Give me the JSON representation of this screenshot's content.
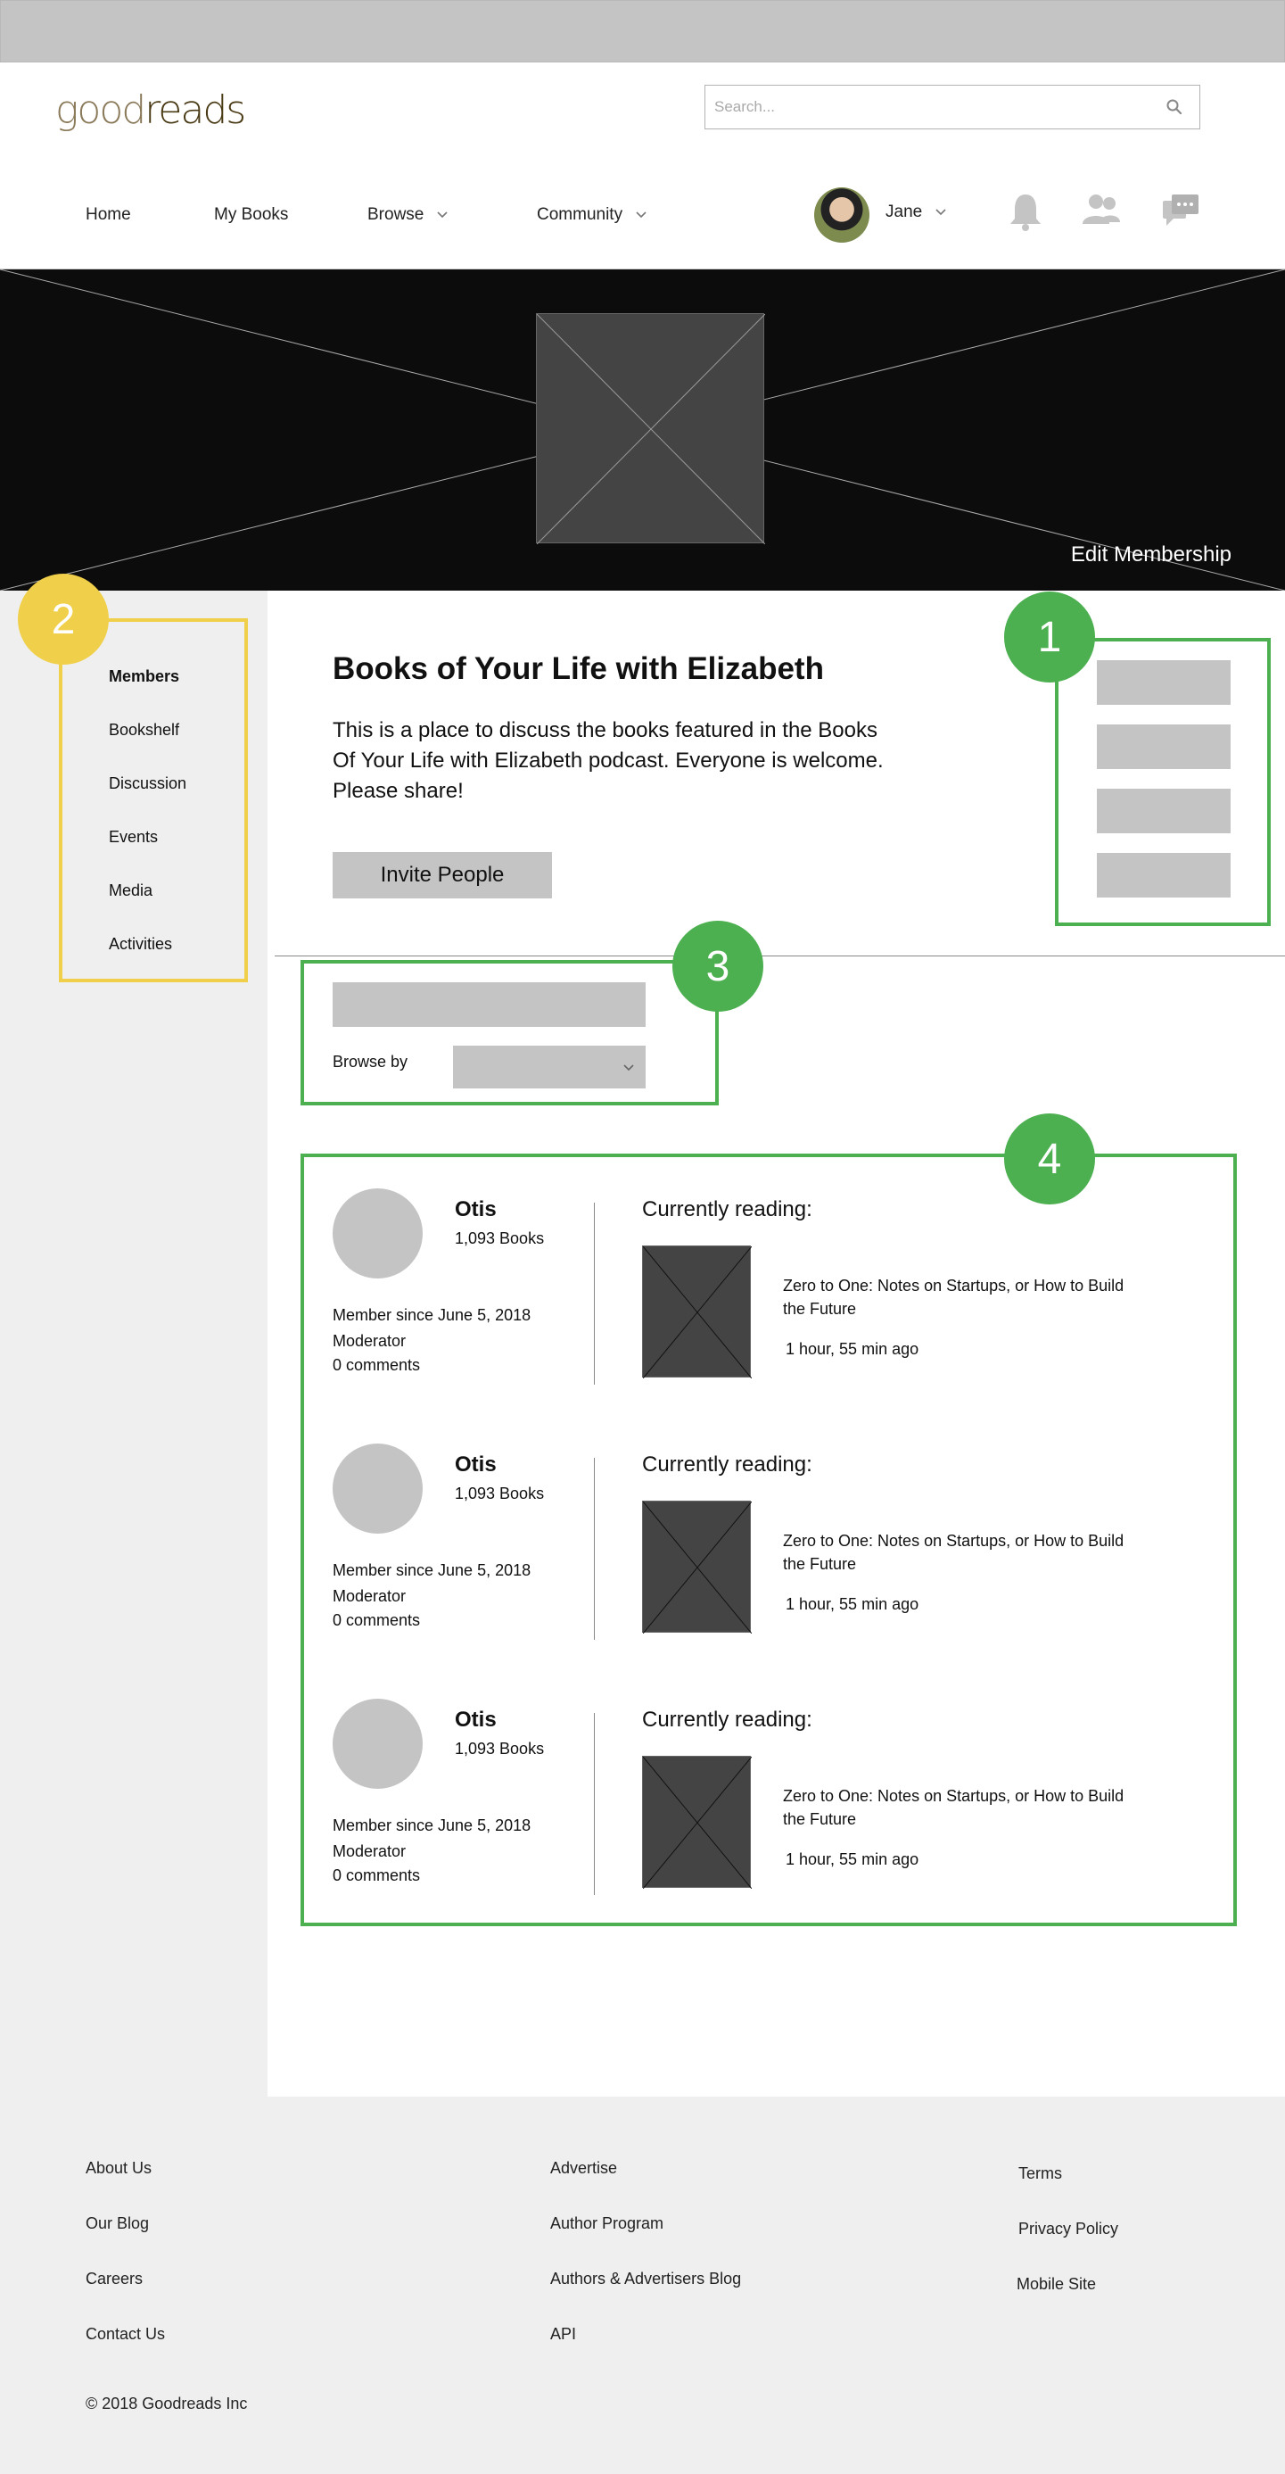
{
  "brand": {
    "logo_part1": "good",
    "logo_part2": "reads"
  },
  "search": {
    "placeholder": "Search..."
  },
  "nav": {
    "home": "Home",
    "my_books": "My Books",
    "browse": "Browse",
    "community": "Community"
  },
  "user": {
    "name": "Jane"
  },
  "header_icons": [
    "bell-icon",
    "friends-icon",
    "messages-icon"
  ],
  "banner": {
    "edit_membership": "Edit Membership"
  },
  "annotations": {
    "one": "1",
    "two": "2",
    "three": "3",
    "four": "4"
  },
  "sidebar": {
    "items": [
      {
        "label": "Members"
      },
      {
        "label": "Bookshelf"
      },
      {
        "label": "Discussion"
      },
      {
        "label": "Events"
      },
      {
        "label": "Media"
      },
      {
        "label": "Activities"
      }
    ]
  },
  "group": {
    "title": "Books of Your Life with Elizabeth",
    "description": "This is a place to discuss the books featured in the Books Of Your Life with Elizabeth podcast. Everyone is welcome. Please share!",
    "invite_label": "Invite People"
  },
  "filters": {
    "browse_label": "Browse by"
  },
  "members": [
    {
      "name": "Otis",
      "books": "1,093 Books",
      "since": "Member since June 5, 2018",
      "role": "Moderator",
      "comments": "0 comments",
      "currently_reading_label": "Currently reading:",
      "book_title": "Zero to One: Notes on Startups, or How to Build the Future",
      "time": "1 hour, 55 min ago"
    },
    {
      "name": "Otis",
      "books": "1,093 Books",
      "since": "Member since June 5, 2018",
      "role": "Moderator",
      "comments": "0 comments",
      "currently_reading_label": "Currently reading:",
      "book_title": "Zero to One: Notes on Startups, or How to Build the Future",
      "time": "1 hour, 55 min ago"
    },
    {
      "name": "Otis",
      "books": "1,093 Books",
      "since": "Member since June 5, 2018",
      "role": "Moderator",
      "comments": "0 comments",
      "currently_reading_label": "Currently reading:",
      "book_title": "Zero to One: Notes on Startups, or How to Build the Future",
      "time": "1 hour, 55 min ago"
    }
  ],
  "footer": {
    "col1": [
      "About Us",
      "Our Blog",
      "Careers",
      "Contact Us"
    ],
    "col2": [
      "Advertise",
      "Author Program",
      "Authors & Advertisers Blog",
      "API"
    ],
    "col3": [
      "Terms",
      "Privacy Policy",
      "Mobile Site"
    ],
    "copyright": "© 2018 Goodreads Inc"
  },
  "colors": {
    "annotation_green": "#4caf50",
    "annotation_yellow": "#f0cf4a",
    "placeholder_gray": "#c4c4c4",
    "banner_black": "#0c0c0c"
  }
}
